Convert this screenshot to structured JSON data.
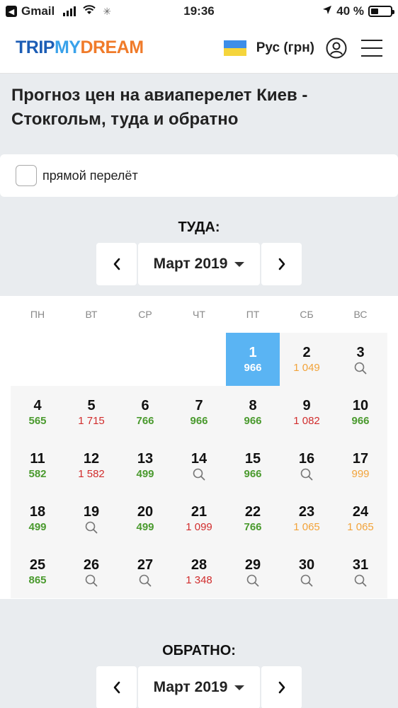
{
  "status_bar": {
    "back_app": "Gmail",
    "time": "19:36",
    "battery": "40 %",
    "battery_level": 0.4
  },
  "header": {
    "logo": {
      "part1": "TRIP",
      "part2": "MY",
      "part3": "DREAM"
    },
    "language": "Рус (грн)"
  },
  "page_title": "Прогноз цен на авиаперелет Киев - Стокгольм, туда и обратно",
  "direct_flight_label": "прямой перелёт",
  "outbound": {
    "title": "ТУДА:",
    "month": "Март 2019",
    "weekdays": [
      "ПН",
      "ВТ",
      "СР",
      "ЧТ",
      "ПТ",
      "СБ",
      "ВС"
    ],
    "leading_empty": 4,
    "days": [
      {
        "day": "1",
        "price": "966",
        "color": "green",
        "selected": true
      },
      {
        "day": "2",
        "price": "1 049",
        "color": "orange"
      },
      {
        "day": "3",
        "price": null
      },
      {
        "day": "4",
        "price": "565",
        "color": "green"
      },
      {
        "day": "5",
        "price": "1 715",
        "color": "red"
      },
      {
        "day": "6",
        "price": "766",
        "color": "green"
      },
      {
        "day": "7",
        "price": "966",
        "color": "green"
      },
      {
        "day": "8",
        "price": "966",
        "color": "green"
      },
      {
        "day": "9",
        "price": "1 082",
        "color": "red"
      },
      {
        "day": "10",
        "price": "966",
        "color": "green"
      },
      {
        "day": "11",
        "price": "582",
        "color": "green"
      },
      {
        "day": "12",
        "price": "1 582",
        "color": "red"
      },
      {
        "day": "13",
        "price": "499",
        "color": "green"
      },
      {
        "day": "14",
        "price": null
      },
      {
        "day": "15",
        "price": "966",
        "color": "green"
      },
      {
        "day": "16",
        "price": null
      },
      {
        "day": "17",
        "price": "999",
        "color": "orange"
      },
      {
        "day": "18",
        "price": "499",
        "color": "green"
      },
      {
        "day": "19",
        "price": null
      },
      {
        "day": "20",
        "price": "499",
        "color": "green"
      },
      {
        "day": "21",
        "price": "1 099",
        "color": "red"
      },
      {
        "day": "22",
        "price": "766",
        "color": "green"
      },
      {
        "day": "23",
        "price": "1 065",
        "color": "orange"
      },
      {
        "day": "24",
        "price": "1 065",
        "color": "orange"
      },
      {
        "day": "25",
        "price": "865",
        "color": "green"
      },
      {
        "day": "26",
        "price": null
      },
      {
        "day": "27",
        "price": null
      },
      {
        "day": "28",
        "price": "1 348",
        "color": "red"
      },
      {
        "day": "29",
        "price": null
      },
      {
        "day": "30",
        "price": null
      },
      {
        "day": "31",
        "price": null
      }
    ]
  },
  "return": {
    "title": "ОБРАТНО:",
    "month": "Март 2019"
  },
  "colors": {
    "selected": "#5ab4f3",
    "green": "#4a9a2e",
    "red": "#d12d2d",
    "orange": "#f2a33a",
    "logo_blue": "#1c5db5",
    "logo_light": "#3aa2ea",
    "logo_orange": "#f07b2a"
  }
}
